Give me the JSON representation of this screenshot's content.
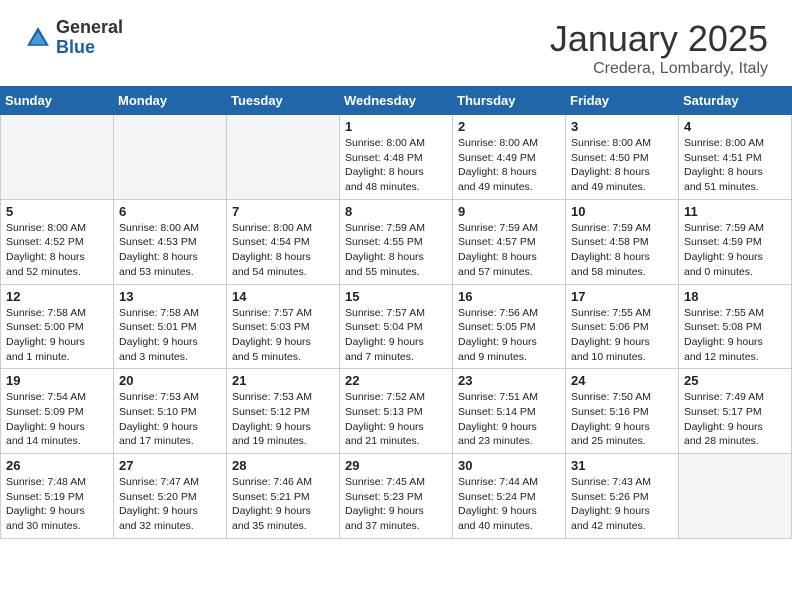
{
  "logo": {
    "general": "General",
    "blue": "Blue"
  },
  "calendar": {
    "title": "January 2025",
    "subtitle": "Credera, Lombardy, Italy",
    "weekdays": [
      "Sunday",
      "Monday",
      "Tuesday",
      "Wednesday",
      "Thursday",
      "Friday",
      "Saturday"
    ],
    "weeks": [
      [
        {
          "day": "",
          "info": ""
        },
        {
          "day": "",
          "info": ""
        },
        {
          "day": "",
          "info": ""
        },
        {
          "day": "1",
          "info": "Sunrise: 8:00 AM\nSunset: 4:48 PM\nDaylight: 8 hours\nand 48 minutes."
        },
        {
          "day": "2",
          "info": "Sunrise: 8:00 AM\nSunset: 4:49 PM\nDaylight: 8 hours\nand 49 minutes."
        },
        {
          "day": "3",
          "info": "Sunrise: 8:00 AM\nSunset: 4:50 PM\nDaylight: 8 hours\nand 49 minutes."
        },
        {
          "day": "4",
          "info": "Sunrise: 8:00 AM\nSunset: 4:51 PM\nDaylight: 8 hours\nand 51 minutes."
        }
      ],
      [
        {
          "day": "5",
          "info": "Sunrise: 8:00 AM\nSunset: 4:52 PM\nDaylight: 8 hours\nand 52 minutes."
        },
        {
          "day": "6",
          "info": "Sunrise: 8:00 AM\nSunset: 4:53 PM\nDaylight: 8 hours\nand 53 minutes."
        },
        {
          "day": "7",
          "info": "Sunrise: 8:00 AM\nSunset: 4:54 PM\nDaylight: 8 hours\nand 54 minutes."
        },
        {
          "day": "8",
          "info": "Sunrise: 7:59 AM\nSunset: 4:55 PM\nDaylight: 8 hours\nand 55 minutes."
        },
        {
          "day": "9",
          "info": "Sunrise: 7:59 AM\nSunset: 4:57 PM\nDaylight: 8 hours\nand 57 minutes."
        },
        {
          "day": "10",
          "info": "Sunrise: 7:59 AM\nSunset: 4:58 PM\nDaylight: 8 hours\nand 58 minutes."
        },
        {
          "day": "11",
          "info": "Sunrise: 7:59 AM\nSunset: 4:59 PM\nDaylight: 9 hours\nand 0 minutes."
        }
      ],
      [
        {
          "day": "12",
          "info": "Sunrise: 7:58 AM\nSunset: 5:00 PM\nDaylight: 9 hours\nand 1 minute."
        },
        {
          "day": "13",
          "info": "Sunrise: 7:58 AM\nSunset: 5:01 PM\nDaylight: 9 hours\nand 3 minutes."
        },
        {
          "day": "14",
          "info": "Sunrise: 7:57 AM\nSunset: 5:03 PM\nDaylight: 9 hours\nand 5 minutes."
        },
        {
          "day": "15",
          "info": "Sunrise: 7:57 AM\nSunset: 5:04 PM\nDaylight: 9 hours\nand 7 minutes."
        },
        {
          "day": "16",
          "info": "Sunrise: 7:56 AM\nSunset: 5:05 PM\nDaylight: 9 hours\nand 9 minutes."
        },
        {
          "day": "17",
          "info": "Sunrise: 7:55 AM\nSunset: 5:06 PM\nDaylight: 9 hours\nand 10 minutes."
        },
        {
          "day": "18",
          "info": "Sunrise: 7:55 AM\nSunset: 5:08 PM\nDaylight: 9 hours\nand 12 minutes."
        }
      ],
      [
        {
          "day": "19",
          "info": "Sunrise: 7:54 AM\nSunset: 5:09 PM\nDaylight: 9 hours\nand 14 minutes."
        },
        {
          "day": "20",
          "info": "Sunrise: 7:53 AM\nSunset: 5:10 PM\nDaylight: 9 hours\nand 17 minutes."
        },
        {
          "day": "21",
          "info": "Sunrise: 7:53 AM\nSunset: 5:12 PM\nDaylight: 9 hours\nand 19 minutes."
        },
        {
          "day": "22",
          "info": "Sunrise: 7:52 AM\nSunset: 5:13 PM\nDaylight: 9 hours\nand 21 minutes."
        },
        {
          "day": "23",
          "info": "Sunrise: 7:51 AM\nSunset: 5:14 PM\nDaylight: 9 hours\nand 23 minutes."
        },
        {
          "day": "24",
          "info": "Sunrise: 7:50 AM\nSunset: 5:16 PM\nDaylight: 9 hours\nand 25 minutes."
        },
        {
          "day": "25",
          "info": "Sunrise: 7:49 AM\nSunset: 5:17 PM\nDaylight: 9 hours\nand 28 minutes."
        }
      ],
      [
        {
          "day": "26",
          "info": "Sunrise: 7:48 AM\nSunset: 5:19 PM\nDaylight: 9 hours\nand 30 minutes."
        },
        {
          "day": "27",
          "info": "Sunrise: 7:47 AM\nSunset: 5:20 PM\nDaylight: 9 hours\nand 32 minutes."
        },
        {
          "day": "28",
          "info": "Sunrise: 7:46 AM\nSunset: 5:21 PM\nDaylight: 9 hours\nand 35 minutes."
        },
        {
          "day": "29",
          "info": "Sunrise: 7:45 AM\nSunset: 5:23 PM\nDaylight: 9 hours\nand 37 minutes."
        },
        {
          "day": "30",
          "info": "Sunrise: 7:44 AM\nSunset: 5:24 PM\nDaylight: 9 hours\nand 40 minutes."
        },
        {
          "day": "31",
          "info": "Sunrise: 7:43 AM\nSunset: 5:26 PM\nDaylight: 9 hours\nand 42 minutes."
        },
        {
          "day": "",
          "info": ""
        }
      ]
    ]
  }
}
